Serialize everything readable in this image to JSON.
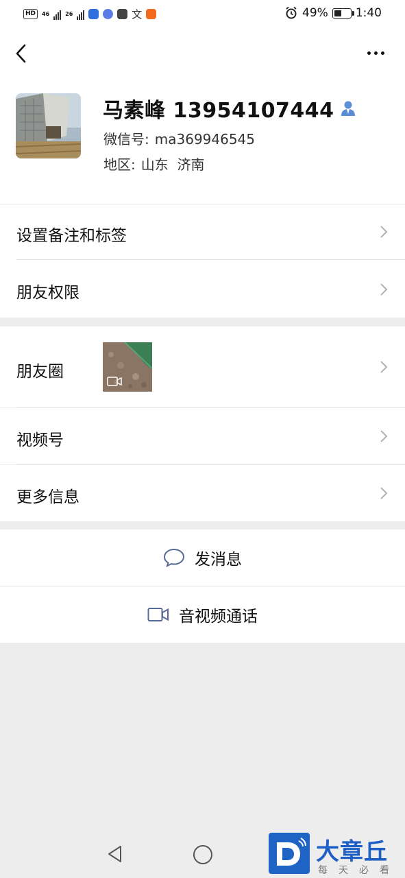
{
  "status_bar": {
    "left_chips": [
      "HD"
    ],
    "signal_1_label": "46",
    "signal_2_label": "26",
    "battery_percent": "49%",
    "time": "1:40",
    "battery_level": 0.49
  },
  "profile": {
    "name": "马素峰 13954107444",
    "wechat_id_label": "微信号:",
    "wechat_id": "ma369946545",
    "region_label": "地区:",
    "region": "山东  济南"
  },
  "menu": {
    "remark_tags": "设置备注和标签",
    "friend_permissions": "朋友权限",
    "moments": "朋友圈",
    "channels": "视频号",
    "more_info": "更多信息"
  },
  "actions": {
    "send_message": "发消息",
    "voice_video_call": "音视频通话"
  },
  "watermark": {
    "title": "大章丘",
    "subtitle": "每天必看"
  },
  "colors": {
    "accent_blue": "#5a8fd6",
    "background": "#ededed",
    "watermark_blue": "#1e5fc6"
  }
}
